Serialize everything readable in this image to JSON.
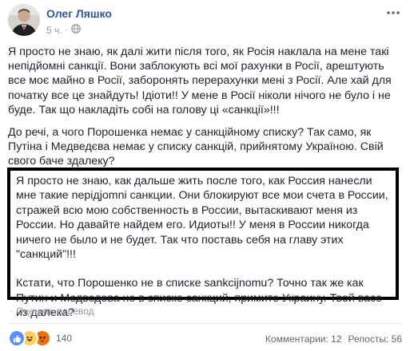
{
  "header": {
    "author": "Олег Ляшко",
    "time": "5 ч.",
    "separator": "·",
    "privacy_icon": "globe-icon",
    "more_icon": "more-options-icon"
  },
  "post": {
    "paragraph1": "Я просто не знаю, як далі жити після того, як Росія наклала на мене такі непідйомні санкції. Вони заблокують всі мої рахунки в Росії, арештують все моє майно в Росії, заборонять перерахунки мені з Росії. Але хай для початку все це знайдуть! Ідіоти!! У мене в Росії ніколи нічого не було і не буде. Так що накладіть собі на голову ці «санкції»!!!",
    "paragraph2": "До речі, а чого Порошенка немає у санкційному списку? Так само, як Путіна і Медведєва немає у списку санкцій, прийнятому Україною. Свій свого баче здалеку?"
  },
  "translation": {
    "paragraph1": "Я просто не знаю, как дальше жить после того, как Россия нанесли мне такие neрiдjomni санкции. Они блокируют все мои счета в России, стражей всю мою собственность в России, вытаскивают меня из России. Но давайте найдем его. Идиоты!! У меня в России никогда ничего не было и не будет. Так что поставь себя на главу этих \"санкций\"!!!",
    "paragraph2": "Кстати, что Порошенко не в списке sankcijnomu? Точно так же как Путин и Медведева не в списке санкций, примите Украину. Твой васе из далека?",
    "rate_label": "Оценить перевод",
    "separator": "·"
  },
  "footer": {
    "reaction_icons": [
      "like-icon",
      "haha-icon",
      "angry-icon"
    ],
    "reaction_count": "140",
    "comments": "Комментарии: 12",
    "reposts": "Репосты: 56"
  },
  "colors": {
    "author": "#365899",
    "meta": "#90949c",
    "text": "#1d2129",
    "translation_border": "#000000",
    "like": "#5890ff",
    "haha": "#fcd05c",
    "angry": "#e9710f"
  }
}
